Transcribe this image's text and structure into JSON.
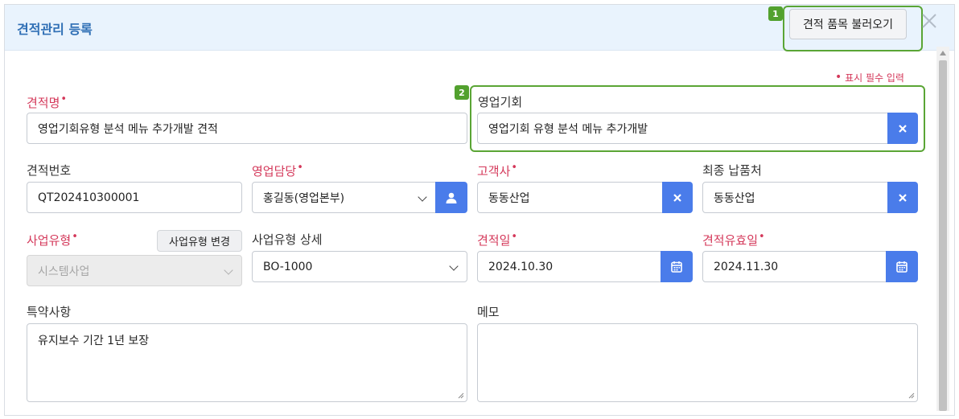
{
  "header": {
    "title": "견적관리 등록",
    "load_items_label": "견적 품목 불러오기",
    "callout_1": "1",
    "close_icon": "close-icon"
  },
  "required_note": {
    "marker": "•",
    "text": "표시 필수 입력"
  },
  "callout_2": "2",
  "accent_color": "#4a7cea",
  "required_color": "#d4385a",
  "highlight_color": "#5aa535",
  "form": {
    "quote_name": {
      "label": "견적명",
      "value": "영업기회유형 분석 메뉴 추가개발 견적"
    },
    "opportunity": {
      "label": "영업기회",
      "value": "영업기회 유형 분석 메뉴 추가개발",
      "button_icon": "clear-icon"
    },
    "quote_number": {
      "label": "견적번호",
      "value": "QT202410300001"
    },
    "sales_rep": {
      "label": "영업담당",
      "value": "홍길동(영업본부)",
      "button_icon": "person-icon"
    },
    "customer": {
      "label": "고객사",
      "value": "동동산업",
      "button_icon": "clear-icon"
    },
    "final_delivery": {
      "label": "최종 납품처",
      "value": "동동산업",
      "button_icon": "clear-icon"
    },
    "business_type": {
      "label": "사업유형",
      "value": "시스템사업",
      "change_button": "사업유형 변경"
    },
    "business_type_detail": {
      "label": "사업유형 상세",
      "value": "BO-1000"
    },
    "quote_date": {
      "label": "견적일",
      "value": "2024.10.30",
      "button_icon": "calendar-icon"
    },
    "valid_until": {
      "label": "견적유효일",
      "value": "2024.11.30",
      "button_icon": "calendar-icon"
    },
    "special_terms": {
      "label": "특약사항",
      "value": "유지보수 기간 1년 보장"
    },
    "memo": {
      "label": "메모",
      "value": ""
    }
  }
}
